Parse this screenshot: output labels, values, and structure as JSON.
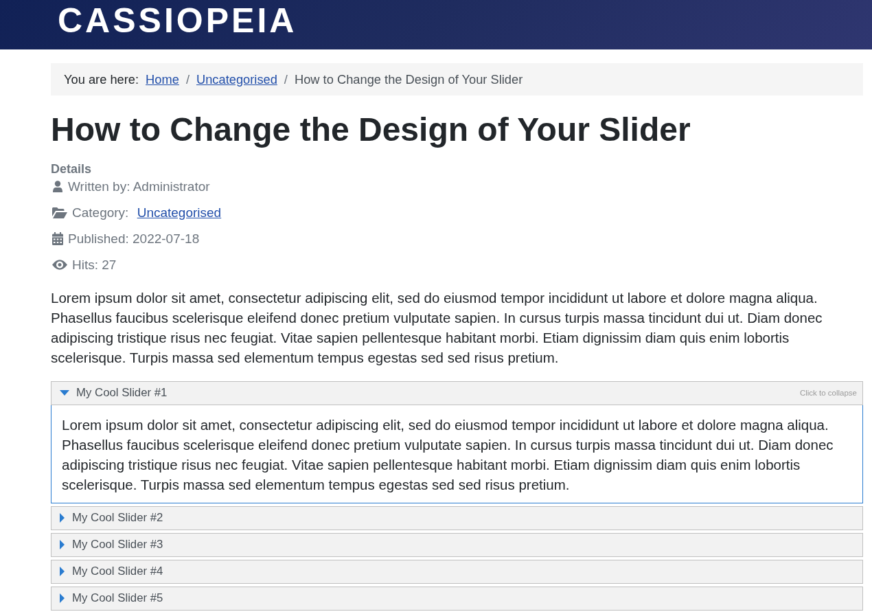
{
  "header": {
    "logo": "CASSIOPEIA"
  },
  "breadcrumb": {
    "label": "You are here:",
    "separator": "/",
    "items": [
      {
        "text": "Home",
        "kind": "link"
      },
      {
        "text": "Uncategorised",
        "kind": "link"
      },
      {
        "text": "How to Change the Design of Your Slider",
        "kind": "current"
      }
    ]
  },
  "article": {
    "title": "How to Change the Design of Your Slider",
    "details": {
      "heading": "Details",
      "items": [
        {
          "kind": "author",
          "label": "Written by: Administrator"
        },
        {
          "kind": "category",
          "label": "Category: ",
          "link": "Uncategorised"
        },
        {
          "kind": "published",
          "label": "Published: 2022-07-18"
        },
        {
          "kind": "hits",
          "label": "Hits: 27"
        }
      ]
    },
    "body": "Lorem ipsum dolor sit amet, consectetur adipiscing elit, sed do eiusmod tempor incididunt ut labore et dolore magna aliqua. Phasellus faucibus scelerisque eleifend donec pretium vulputate sapien. In cursus turpis massa tincidunt dui ut. Diam donec adipiscing tristique risus nec feugiat. Vitae sapien pellentesque habitant morbi. Etiam dignissim diam quis enim lobortis scelerisque. Turpis massa sed elementum tempus egestas sed sed risus pretium."
  },
  "sliders": [
    {
      "title": "My Cool Slider #1",
      "expanded": true,
      "hint": "Click to collapse",
      "content": "Lorem ipsum dolor sit amet, consectetur adipiscing elit, sed do eiusmod tempor incididunt ut labore et dolore magna aliqua. Phasellus faucibus scelerisque eleifend donec pretium vulputate sapien. In cursus turpis massa tincidunt dui ut. Diam donec adipiscing tristique risus nec feugiat. Vitae sapien pellentesque habitant morbi. Etiam dignissim diam quis enim lobortis scelerisque. Turpis massa sed elementum tempus egestas sed sed risus pretium."
    },
    {
      "title": "My Cool Slider #2",
      "expanded": false
    },
    {
      "title": "My Cool Slider #3",
      "expanded": false
    },
    {
      "title": "My Cool Slider #4",
      "expanded": false
    },
    {
      "title": "My Cool Slider #5",
      "expanded": false
    }
  ]
}
